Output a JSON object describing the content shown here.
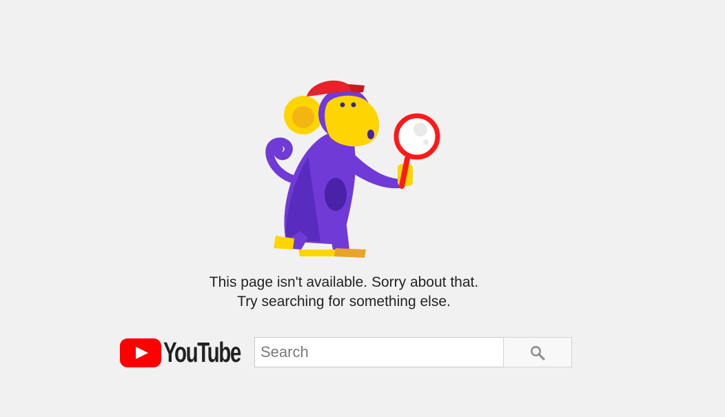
{
  "error": {
    "line1": "This page isn't available. Sorry about that.",
    "line2": "Try searching for something else."
  },
  "logo": {
    "wordmark": "YouTube",
    "brand_color": "#ff0000"
  },
  "search": {
    "placeholder": "Search",
    "value": ""
  },
  "illustration": {
    "icon": "monkey-with-magnifier-icon",
    "body_color": "#6f3ad6",
    "face_color": "#ffd500",
    "cap_color": "#e8222b"
  }
}
